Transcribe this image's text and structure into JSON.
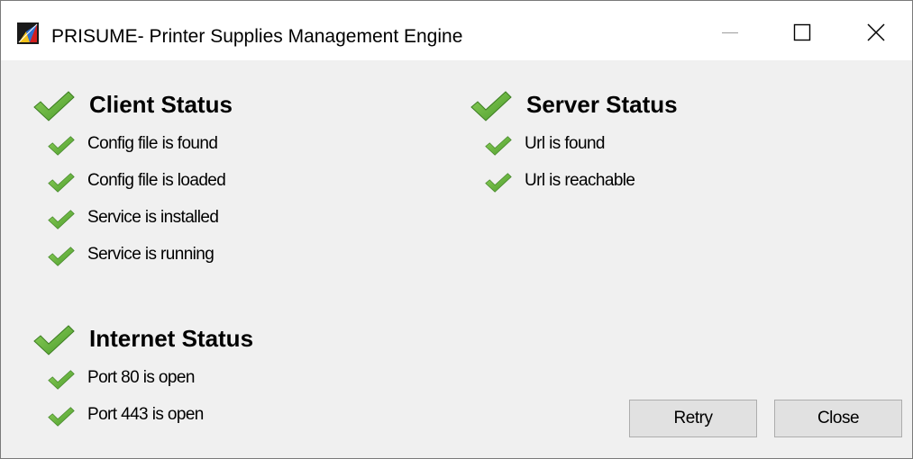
{
  "window": {
    "title": "PRISUME- Printer Supplies Management Engine",
    "icon": "prisume-logo-icon",
    "controls": [
      "minimize-icon",
      "maximize-icon",
      "close-icon"
    ]
  },
  "client_status": {
    "title": "Client Status",
    "items": [
      "Config file is found",
      "Config file is loaded",
      "Service is installed",
      "Service is running"
    ]
  },
  "server_status": {
    "title": "Server Status",
    "items": [
      "Url is found",
      "Url is reachable"
    ]
  },
  "internet_status": {
    "title": "Internet Status",
    "items": [
      "Port 80 is open",
      "Port 443 is open"
    ]
  },
  "buttons": {
    "retry_label": "Retry",
    "close_label": "Close"
  },
  "colors": {
    "check_green": "#4a9a2c",
    "check_light": "#8ccf58",
    "window_bg": "#f0f0f0",
    "button_bg": "#e1e1e1"
  },
  "icons": {
    "status_ok": "checkmark-icon"
  }
}
